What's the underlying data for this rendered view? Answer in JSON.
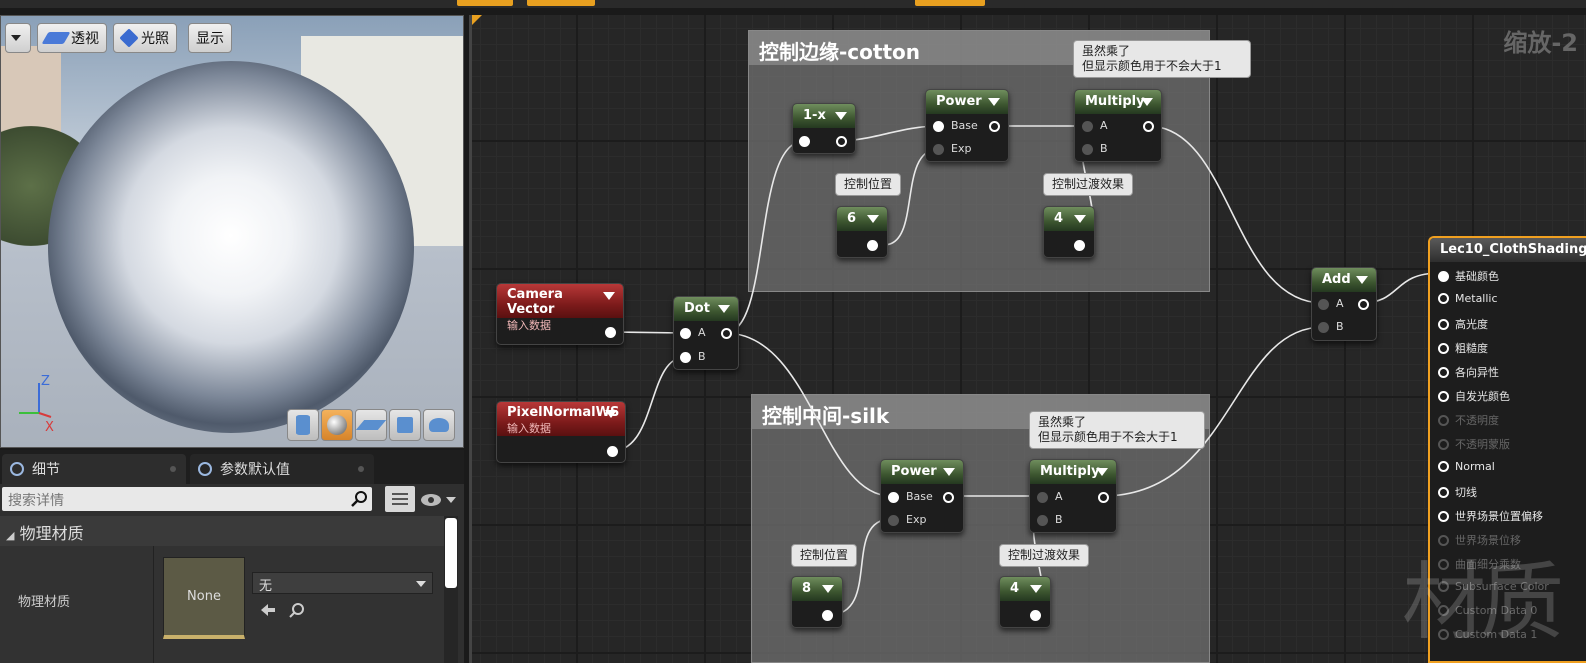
{
  "viewport": {
    "toolbar": {
      "transparent_label": "透视",
      "lighting_label": "光照",
      "show_label": "显示"
    },
    "axes": {
      "z": "Z",
      "x": "X"
    },
    "shape_tools": [
      "cylinder-icon",
      "sphere-icon",
      "plane-icon",
      "cube-icon",
      "teapot-icon"
    ]
  },
  "details": {
    "tabs": [
      {
        "label": "细节",
        "icon": "details-icon"
      },
      {
        "label": "参数默认值",
        "icon": "parameters-icon"
      }
    ],
    "search_placeholder": "搜索详情",
    "category": "物理材质",
    "property_label": "物理材质",
    "thumb_label": "None",
    "combo_value": "无"
  },
  "graph": {
    "zoom_label": "缩放-2",
    "watermark": "材质",
    "comments": [
      {
        "title": "控制边缘-cotton"
      },
      {
        "title": "控制中间-silk"
      }
    ],
    "bubbles": {
      "multiply_top": [
        "虽然乘了",
        "但显示颜色用于不会大于1"
      ],
      "multiply_bottom": [
        "虽然乘了",
        "但显示颜色用于不会大于1"
      ],
      "pos_top": "控制位置",
      "trans_top": "控制过渡效果",
      "pos_bottom": "控制位置",
      "trans_bottom": "控制过渡效果"
    },
    "nodes": {
      "camera_vector": {
        "title": "Camera Vector",
        "subtitle": "输入数据"
      },
      "pixel_normal": {
        "title": "PixelNormalWS",
        "subtitle": "输入数据"
      },
      "dot": {
        "title": "Dot",
        "pin_a": "A",
        "pin_b": "B"
      },
      "one_minus": {
        "title": "1-x"
      },
      "power_top": {
        "title": "Power",
        "pin_base": "Base",
        "pin_exp": "Exp"
      },
      "multiply_top": {
        "title": "Multiply",
        "pin_a": "A",
        "pin_b": "B"
      },
      "const6": {
        "title": "6"
      },
      "const4_top": {
        "title": "4"
      },
      "add": {
        "title": "Add",
        "pin_a": "A",
        "pin_b": "B"
      },
      "power_bottom": {
        "title": "Power",
        "pin_base": "Base",
        "pin_exp": "Exp"
      },
      "multiply_bottom": {
        "title": "Multiply",
        "pin_a": "A",
        "pin_b": "B"
      },
      "const8": {
        "title": "8"
      },
      "const4_bottom": {
        "title": "4"
      }
    },
    "output": {
      "title": "Lec10_ClothShading",
      "rows": [
        {
          "label": "基础颜色",
          "active": true,
          "connected": true
        },
        {
          "label": "Metallic",
          "active": true,
          "connected": false
        },
        {
          "label": "高光度",
          "active": true,
          "connected": false
        },
        {
          "label": "粗糙度",
          "active": true,
          "connected": false
        },
        {
          "label": "各向异性",
          "active": true,
          "connected": false
        },
        {
          "label": "自发光颜色",
          "active": true,
          "connected": false
        },
        {
          "label": "不透明度",
          "active": false,
          "connected": false
        },
        {
          "label": "不透明蒙版",
          "active": false,
          "connected": false
        },
        {
          "label": "Normal",
          "active": true,
          "connected": false
        },
        {
          "label": "切线",
          "active": true,
          "connected": false
        },
        {
          "label": "世界场景位置偏移",
          "active": true,
          "connected": false
        },
        {
          "label": "世界场景位移",
          "active": false,
          "connected": false
        },
        {
          "label": "曲面细分乘数",
          "active": false,
          "connected": false
        },
        {
          "label": "Subsurface Color",
          "active": false,
          "connected": false
        },
        {
          "label": "Custom Data 0",
          "active": false,
          "connected": false
        },
        {
          "label": "Custom Data 1",
          "active": false,
          "connected": false
        }
      ]
    }
  }
}
